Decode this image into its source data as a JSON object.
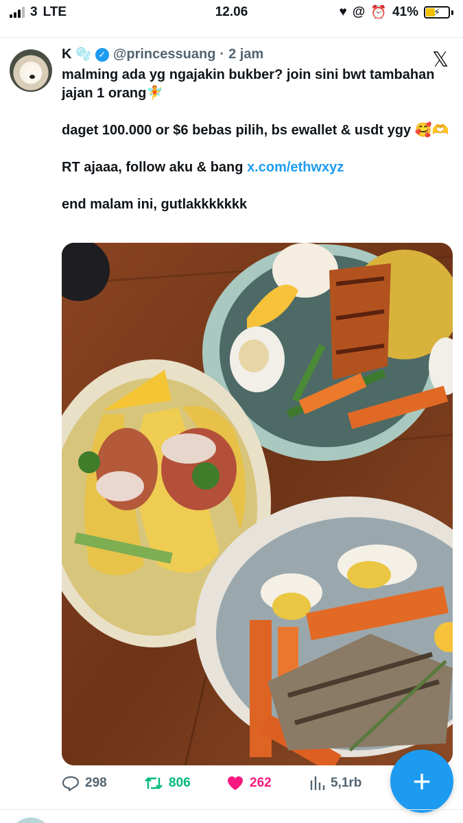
{
  "status_bar": {
    "carrier": "3",
    "network": "LTE",
    "time": "12.06",
    "battery_percent": "41%",
    "battery_level": 0.41,
    "icons": [
      "signal-icon",
      "heart-icon",
      "at-icon",
      "alarm-icon",
      "battery-icon"
    ]
  },
  "post": {
    "display_name": "K",
    "name_emoji": "🫧",
    "handle": "@princessuang",
    "separator": "·",
    "timestamp": "2 jam",
    "lines": [
      "malming ada yg ngajakin bukber? join sini bwt tambahan jajan  1 orang🧚",
      "daget 100.000 or $6 bebas pilih, bs ewallet & usdt ygy 🥰🫶",
      "end malam ini, gutlakkkkkkk"
    ],
    "line_rt_prefix": "RT ajaaa, follow aku & bang ",
    "line_rt_link": "x.com/ethwxyz",
    "x_logo": "𝕏"
  },
  "actions": {
    "replies": "298",
    "retweets": "806",
    "likes": "262",
    "views": "5,1rb"
  },
  "fab": {
    "label": "+"
  },
  "colors": {
    "accent": "#1d9bf0",
    "retweet": "#00ba7c",
    "like": "#f91880",
    "muted": "#536471"
  }
}
